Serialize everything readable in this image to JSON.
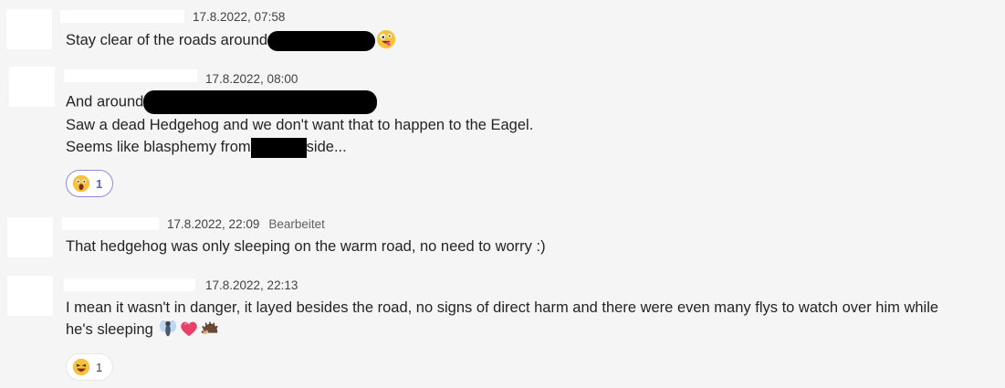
{
  "messages": [
    {
      "timestamp": "17.8.2022, 07:58",
      "edited": "",
      "lines": [
        {
          "before": "Stay clear of the roads around",
          "after": ""
        }
      ],
      "reaction": null
    },
    {
      "timestamp": "17.8.2022, 08:00",
      "edited": "",
      "lines": [
        {
          "before": "And around",
          "after": ""
        },
        {
          "before": "Saw a dead Hedgehog and we don't want that to happen to the Eagel.",
          "after": ""
        },
        {
          "before": "Seems like blasphemy from",
          "after": "side..."
        }
      ],
      "reaction": {
        "emoji": "surprised-face",
        "count": "1",
        "selected": true
      }
    },
    {
      "timestamp": "17.8.2022, 22:09",
      "edited": "Bearbeitet",
      "lines": [
        {
          "before": "That hedgehog was only sleeping on the warm road, no need to worry :)",
          "after": ""
        }
      ],
      "reaction": null
    },
    {
      "timestamp": "17.8.2022, 22:13",
      "edited": "",
      "lines": [
        {
          "before": "I mean it wasn't in danger, it layed besides the road, no signs of direct harm and there were even many flys to watch over him while",
          "after": ""
        },
        {
          "before": "he's sleeping",
          "after": ""
        }
      ],
      "reaction": {
        "emoji": "laughing-face",
        "count": "1",
        "selected": false
      }
    }
  ],
  "colors": {
    "background": "#f5f5f5",
    "text": "#242424",
    "meta": "#424242",
    "accent": "#5b5fc7",
    "redaction": "#000000"
  },
  "icons": [
    "zany-face-icon",
    "surprised-face-icon",
    "fly-icon",
    "heart-icon",
    "hedgehog-icon",
    "laughing-face-icon"
  ]
}
